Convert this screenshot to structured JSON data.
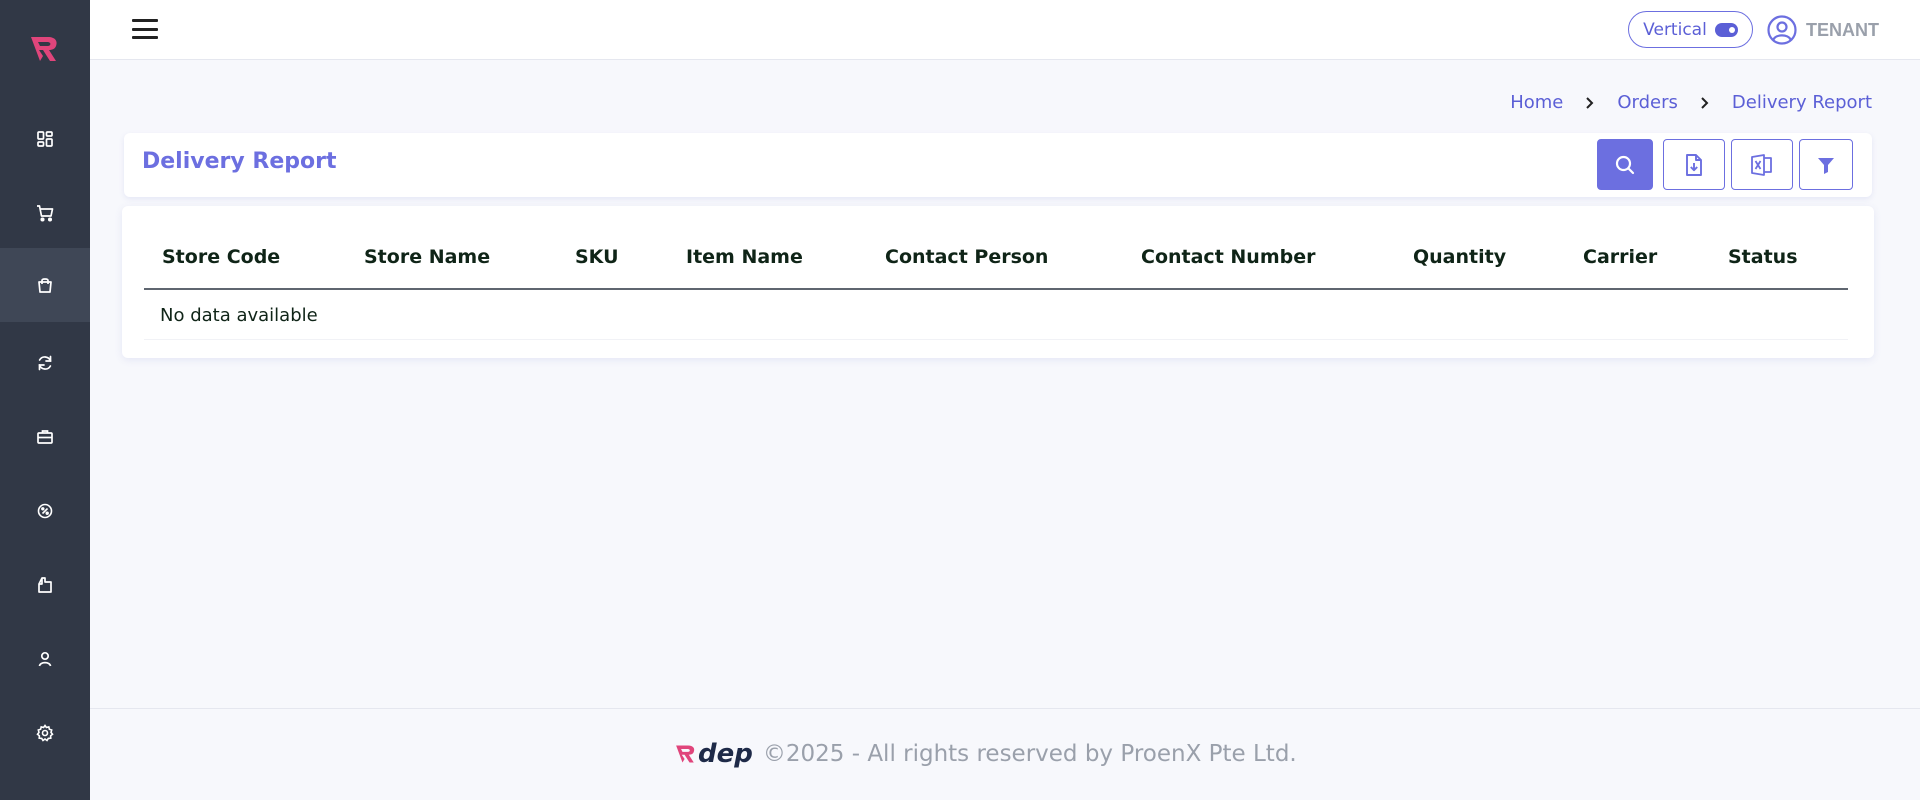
{
  "brand": {
    "logo_letter": "R",
    "footer_logo_text": "dep",
    "primary_color": "#6c6fe0",
    "logo_color": "#e0457b"
  },
  "sidebar": {
    "items": [
      {
        "icon": "dashboard-icon"
      },
      {
        "icon": "cart-icon"
      },
      {
        "icon": "shopping-bag-icon",
        "active": true
      },
      {
        "icon": "refresh-icon"
      },
      {
        "icon": "briefcase-icon"
      },
      {
        "icon": "badge-percent-icon"
      },
      {
        "icon": "document-icon"
      },
      {
        "icon": "user-icon"
      },
      {
        "icon": "gear-icon"
      }
    ]
  },
  "header": {
    "layout_toggle_label": "Vertical",
    "user_name": "TENANT"
  },
  "breadcrumb": [
    "Home",
    "Orders",
    "Delivery Report"
  ],
  "page": {
    "title": "Delivery Report",
    "actions": [
      {
        "name": "search-button",
        "icon": "search-icon"
      },
      {
        "name": "download-button",
        "icon": "file-download-icon"
      },
      {
        "name": "excel-export-button",
        "icon": "excel-icon"
      },
      {
        "name": "filter-button",
        "icon": "filter-icon"
      }
    ]
  },
  "table": {
    "columns": [
      "Store Code",
      "Store Name",
      "SKU",
      "Item Name",
      "Contact Person",
      "Contact Number",
      "Quantity",
      "Carrier",
      "Status"
    ],
    "rows": [],
    "empty_text": "No data available"
  },
  "footer": {
    "text": "©2025 - All rights reserved by ProenX Pte Ltd."
  }
}
